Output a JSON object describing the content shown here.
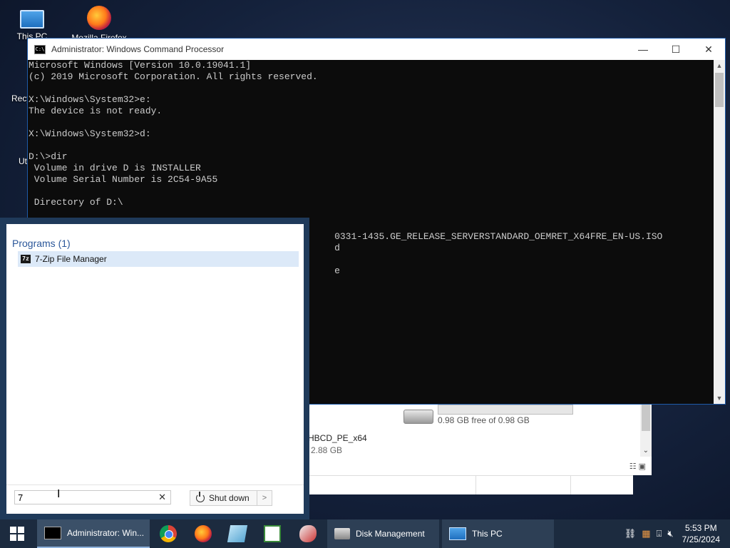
{
  "desktop": {
    "icons": [
      {
        "label": "This PC"
      },
      {
        "label": "Mozilla Firefox"
      }
    ],
    "partial_labels": [
      "Recy",
      "Ut"
    ]
  },
  "cmd_window": {
    "title": "Administrator: Windows Command Processor",
    "controls": {
      "minimize": "—",
      "maximize": "☐",
      "close": "✕"
    },
    "lines": [
      "Microsoft Windows [Version 10.0.19041.1]",
      "(c) 2019 Microsoft Corporation. All rights reserved.",
      "",
      "X:\\Windows\\System32>e:",
      "The device is not ready.",
      "",
      "X:\\Windows\\System32>d:",
      "",
      "D:\\>dir",
      " Volume in drive D is INSTALLER",
      " Volume Serial Number is 2C54-9A55",
      "",
      " Directory of D:\\",
      "",
      "",
      "                                                       0331-1435.GE_RELEASE_SERVERSTANDARD_OEMRET_X64FRE_EN-US.ISO",
      "                                                       d",
      "",
      "                                                       e"
    ]
  },
  "explorer": {
    "drive_free": "0.98 GB free of 0.98 GB",
    "drive_free_fraction": 0.0,
    "item_name": "HBCD_PE_x64",
    "item_size": "2.88 GB"
  },
  "start_menu": {
    "group_header": "Programs (1)",
    "results": [
      {
        "label": "7-Zip File Manager",
        "icon": "7z"
      }
    ],
    "search_value": "7",
    "clear_icon": "✕",
    "shutdown_label": "Shut down",
    "shutdown_arrow": ">"
  },
  "taskbar": {
    "tasks": [
      {
        "label": "Administrator: Win..."
      },
      {
        "label": "Disk Management"
      },
      {
        "label": "This PC"
      }
    ],
    "pinned": [
      "chrome-icon",
      "firefox-icon",
      "notepad-icon",
      "spreadsheet-icon",
      "paint-icon"
    ],
    "clock": {
      "time": "5:53 PM",
      "date": "7/25/2024"
    }
  }
}
